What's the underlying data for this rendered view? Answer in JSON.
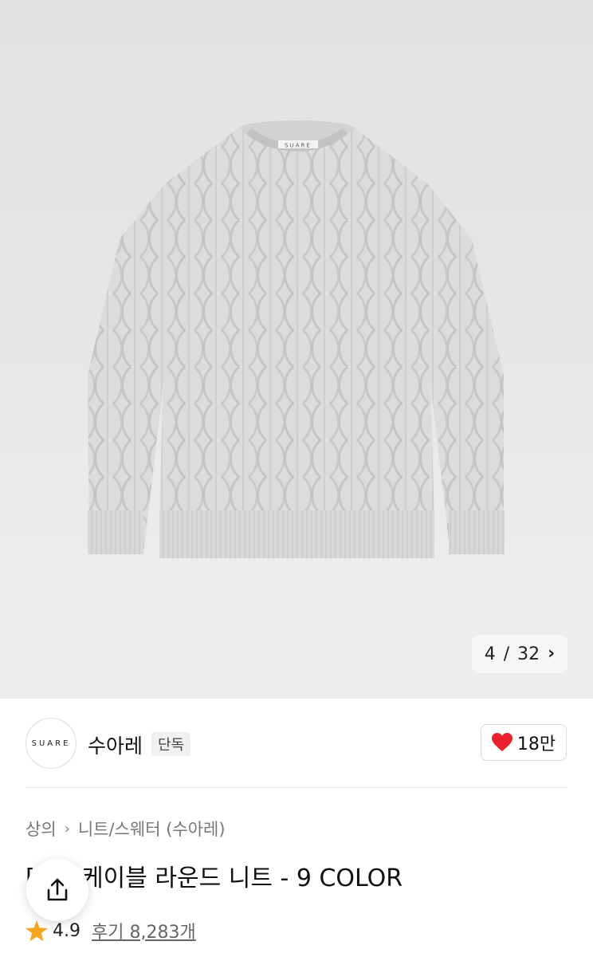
{
  "product_image": {
    "label_on_garment": "SUARE",
    "pager": {
      "current": "4",
      "separator": "/",
      "total": "32"
    }
  },
  "brand": {
    "logo_text": "SUARE",
    "name": "수아레",
    "tag": "단독"
  },
  "like": {
    "count": "18만",
    "icon": "heart-icon",
    "color": "#e8212c"
  },
  "breadcrumb": [
    "상의",
    "니트/스웨터 (수아레)"
  ],
  "title": "[ 얼] 케이블 라운드 니트 - 9 COLOR",
  "rating": {
    "score": "4.9",
    "reviews": "후기 8,283개",
    "star_color": "#f5a623"
  },
  "share": {
    "icon": "share-icon"
  }
}
